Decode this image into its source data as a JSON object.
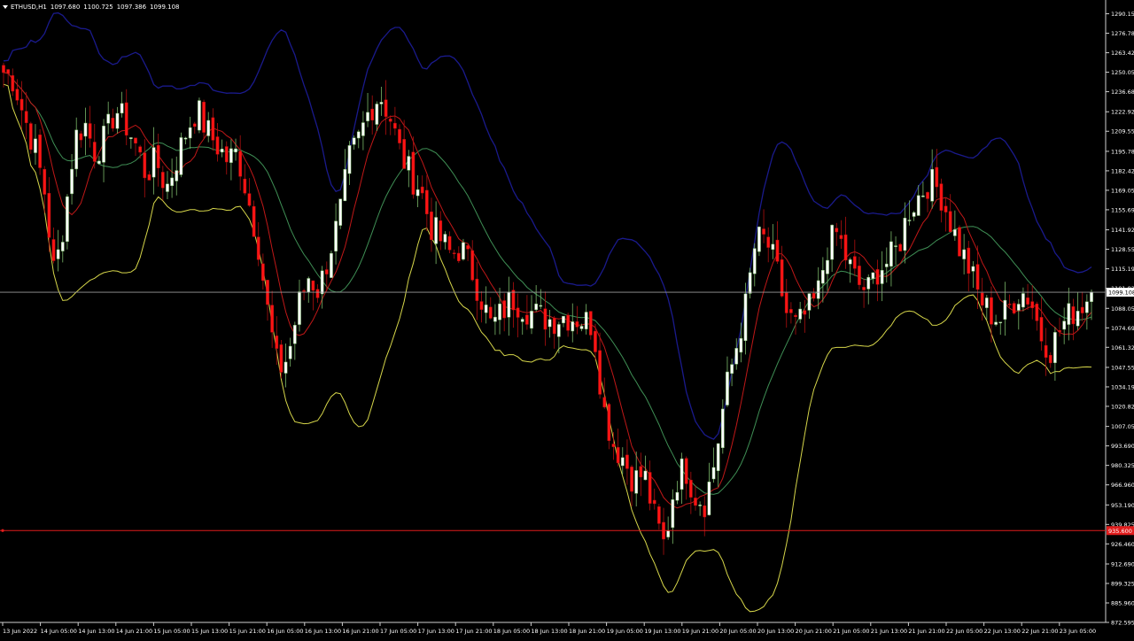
{
  "header": {
    "symbol": "ETHUSD,H1",
    "open": "1097.680",
    "high": "1100.725",
    "low": "1097.386",
    "close": "1099.108"
  },
  "colors": {
    "background": "#000000",
    "bull_candle": "#ffffff",
    "bear_candle": "#ff1414",
    "bull_outline": "#7bb86a",
    "bear_outline": "#b01010",
    "upper_band": "#1a1a8c",
    "lower_band": "#d6d64a",
    "middle_ma": "#3f8f55",
    "fast_ma": "#c01818",
    "current_price_line": "#9a9a9a",
    "marked_level_line": "#e01c1c",
    "axis_text": "#ffffff"
  },
  "chart_data": {
    "type": "candlestick",
    "symbol": "ETHUSD",
    "timeframe": "H1",
    "ylim": [
      872.595,
      1299.6
    ],
    "y_ticks": [
      "1290.155",
      "1276.785",
      "1263.420",
      "1250.055",
      "1236.685",
      "1222.920",
      "1209.555",
      "1195.780",
      "1182.420",
      "1169.055",
      "1155.690",
      "1141.925",
      "1128.555",
      "1115.190",
      "1101.820",
      "1088.055",
      "1074.690",
      "1061.325",
      "1047.555",
      "1034.190",
      "1020.825",
      "1007.055",
      "993.690",
      "980.325",
      "966.960",
      "953.190",
      "939.825",
      "926.460",
      "912.690",
      "899.325",
      "885.960",
      "872.595"
    ],
    "x_ticks": [
      "13 Jun 2022",
      "14 Jun 05:00",
      "14 Jun 13:00",
      "14 Jun 21:00",
      "15 Jun 05:00",
      "15 Jun 13:00",
      "15 Jun 21:00",
      "16 Jun 05:00",
      "16 Jun 13:00",
      "16 Jun 21:00",
      "17 Jun 05:00",
      "17 Jun 13:00",
      "17 Jun 21:00",
      "18 Jun 05:00",
      "18 Jun 13:00",
      "18 Jun 21:00",
      "19 Jun 05:00",
      "19 Jun 13:00",
      "19 Jun 21:00",
      "20 Jun 05:00",
      "20 Jun 13:00",
      "20 Jun 21:00",
      "21 Jun 05:00",
      "21 Jun 13:00",
      "21 Jun 21:00",
      "22 Jun 05:00",
      "22 Jun 13:00",
      "22 Jun 21:00",
      "23 Jun 05:00"
    ],
    "current_price": 1099.108,
    "current_price_label": "1099.108",
    "marked_level": 935.6,
    "marked_level_label": "935.600",
    "indicators": [
      "Bollinger Bands",
      "Moving Average"
    ],
    "grid": false,
    "close_path": [
      1250,
      1245,
      1220,
      1200,
      1170,
      1110,
      1150,
      1205,
      1215,
      1195,
      1205,
      1225,
      1215,
      1200,
      1180,
      1190,
      1170,
      1190,
      1210,
      1225,
      1210,
      1200,
      1190,
      1195,
      1165,
      1135,
      1085,
      1045,
      1055,
      1090,
      1110,
      1100,
      1125,
      1150,
      1190,
      1205,
      1225,
      1235,
      1220,
      1195,
      1180,
      1170,
      1145,
      1135,
      1125,
      1130,
      1115,
      1095,
      1075,
      1085,
      1095,
      1090,
      1085,
      1082,
      1080,
      1083,
      1082,
      1080,
      1077,
      1020,
      995,
      985,
      970,
      975,
      945,
      925,
      968,
      980,
      960,
      955,
      985,
      1030,
      1060,
      1090,
      1135,
      1135,
      1115,
      1085,
      1075,
      1085,
      1095,
      1130,
      1140,
      1120,
      1105,
      1100,
      1115,
      1120,
      1130,
      1155,
      1165,
      1175,
      1170,
      1150,
      1130,
      1115,
      1095,
      1085,
      1080,
      1090,
      1100,
      1095,
      1070,
      1060,
      1075,
      1085,
      1090,
      1099.108
    ]
  }
}
